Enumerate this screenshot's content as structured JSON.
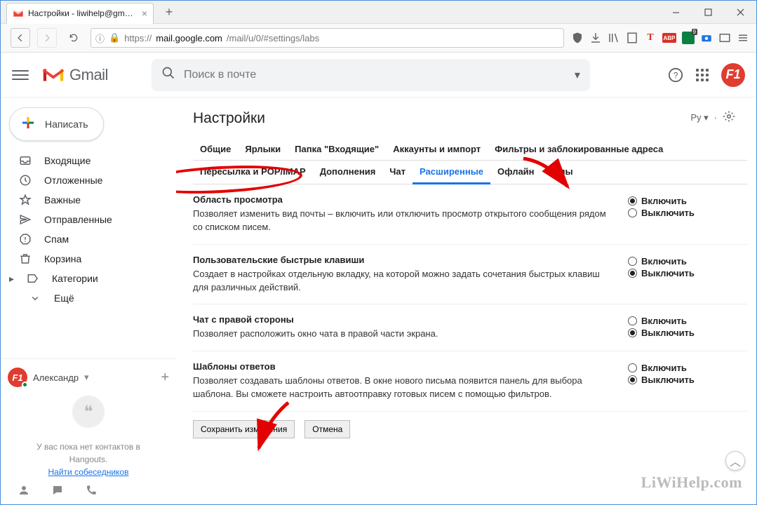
{
  "browser": {
    "tab_title": "Настройки - liwihelp@gmail.c",
    "url_prefix": "https://",
    "url_host": "mail.google.com",
    "url_path": "/mail/u/0/#settings/labs"
  },
  "header": {
    "product": "Gmail",
    "search_placeholder": "Поиск в почте",
    "avatar_text": "F1"
  },
  "sidebar": {
    "compose": "Написать",
    "items": [
      {
        "icon": "inbox",
        "label": "Входящие"
      },
      {
        "icon": "clock",
        "label": "Отложенные"
      },
      {
        "icon": "star",
        "label": "Важные"
      },
      {
        "icon": "send",
        "label": "Отправленные"
      },
      {
        "icon": "spam",
        "label": "Спам"
      },
      {
        "icon": "trash",
        "label": "Корзина"
      },
      {
        "icon": "label",
        "label": "Категории"
      },
      {
        "icon": "more",
        "label": "Ещё"
      }
    ]
  },
  "hangouts": {
    "user": "Александр",
    "empty1": "У вас пока нет контактов в",
    "empty2": "Hangouts.",
    "find_link": "Найти собеседников"
  },
  "content": {
    "page_title": "Настройки",
    "lang": "Ру",
    "tabs_row1": [
      "Общие",
      "Ярлыки",
      "Папка \"Входящие\"",
      "Аккаунты и импорт",
      "Фильтры и заблокированные адреса"
    ],
    "tabs_row2": [
      "Пересылка и POP/IMAP",
      "Дополнения",
      "Чат",
      "Расширенные",
      "Офлайн",
      "Темы"
    ],
    "active_tab": "Расширенные",
    "options": {
      "enable": "Включить",
      "disable": "Выключить"
    },
    "sections": [
      {
        "title": "Область просмотра",
        "desc": "Позволяет изменить вид почты – включить или отключить просмотр открытого сообщения рядом со списком писем.",
        "selected": "enable"
      },
      {
        "title": "Пользовательские быстрые клавиши",
        "desc": "Создает в настройках отдельную вкладку, на которой можно задать сочетания быстрых клавиш для различных действий.",
        "selected": "disable"
      },
      {
        "title": "Чат с правой стороны",
        "desc": "Позволяет расположить окно чата в правой части экрана.",
        "selected": "disable"
      },
      {
        "title": "Шаблоны ответов",
        "desc": "Позволяет создавать шаблоны ответов. В окне нового письма появится панель для выбора шаблона. Вы сможете настроить автоотправку готовых писем с помощью фильтров.",
        "selected": "disable"
      }
    ],
    "buttons": {
      "save": "Сохранить изменения",
      "cancel": "Отмена"
    }
  },
  "watermark": "LiWiHelp.com"
}
